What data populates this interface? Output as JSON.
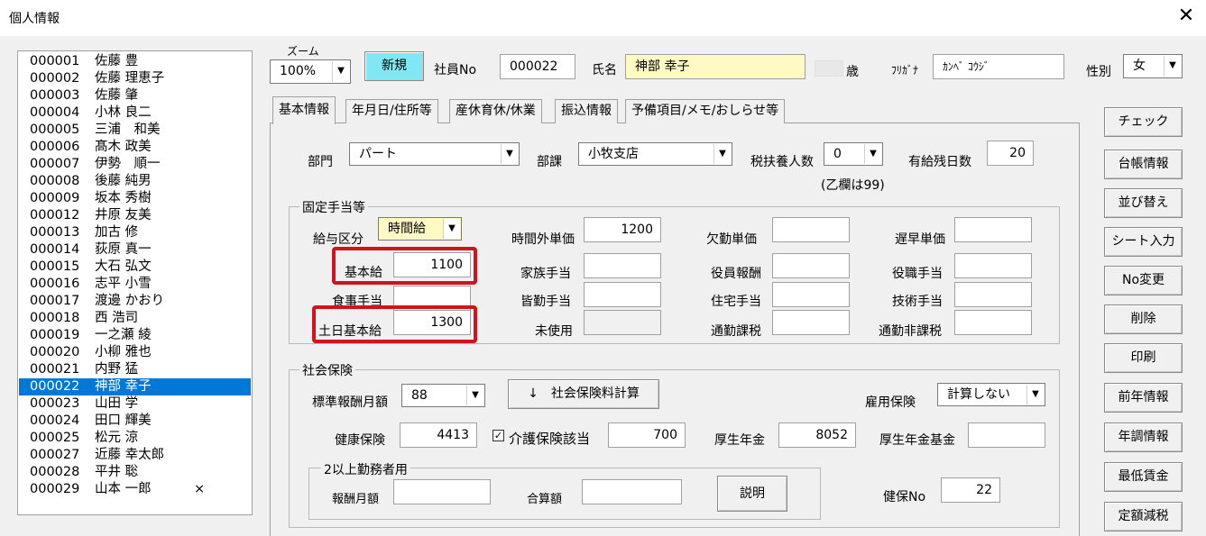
{
  "window": {
    "title": "個人情報",
    "close_glyph": "✕"
  },
  "employees": [
    {
      "no": "000001",
      "name": "佐藤 豊",
      "mark": ""
    },
    {
      "no": "000002",
      "name": "佐藤 理恵子",
      "mark": ""
    },
    {
      "no": "000003",
      "name": "佐藤 肇",
      "mark": ""
    },
    {
      "no": "000004",
      "name": "小林 良二",
      "mark": ""
    },
    {
      "no": "000005",
      "name": "三浦　和美",
      "mark": ""
    },
    {
      "no": "000006",
      "name": "髙木 政美",
      "mark": ""
    },
    {
      "no": "000007",
      "name": "伊勢　順一",
      "mark": ""
    },
    {
      "no": "000008",
      "name": "後藤 純男",
      "mark": ""
    },
    {
      "no": "000009",
      "name": "坂本 秀樹",
      "mark": ""
    },
    {
      "no": "000012",
      "name": "井原 友美",
      "mark": ""
    },
    {
      "no": "000013",
      "name": "加古 修",
      "mark": ""
    },
    {
      "no": "000014",
      "name": "荻原 真一",
      "mark": ""
    },
    {
      "no": "000015",
      "name": "大石 弘文",
      "mark": ""
    },
    {
      "no": "000016",
      "name": "志平 小雪",
      "mark": ""
    },
    {
      "no": "000017",
      "name": "渡邊 かおり",
      "mark": ""
    },
    {
      "no": "000018",
      "name": "西 浩司",
      "mark": ""
    },
    {
      "no": "000019",
      "name": "一之瀬 綾",
      "mark": ""
    },
    {
      "no": "000020",
      "name": "小柳 雅也",
      "mark": ""
    },
    {
      "no": "000021",
      "name": "内野 猛",
      "mark": ""
    },
    {
      "no": "000022",
      "name": "神部 幸子",
      "mark": ""
    },
    {
      "no": "000023",
      "name": "山田 学",
      "mark": ""
    },
    {
      "no": "000024",
      "name": "田口 輝美",
      "mark": ""
    },
    {
      "no": "000025",
      "name": "松元 涼",
      "mark": ""
    },
    {
      "no": "000027",
      "name": "近藤 幸太郎",
      "mark": ""
    },
    {
      "no": "000028",
      "name": "平井 聡",
      "mark": ""
    },
    {
      "no": "000029",
      "name": "山本 一郎",
      "mark": "×"
    }
  ],
  "selected_employee_no": "000022",
  "header": {
    "zoom_label": "ズーム",
    "zoom_value": "100%",
    "new_button": "新規",
    "emp_no_label": "社員No",
    "emp_no_value": "000022",
    "name_label": "氏名",
    "name_value": "神部 幸子",
    "age_value": "",
    "age_label": "歳",
    "furigana_label": "ﾌﾘｶﾞﾅ",
    "furigana_value": "ｶﾝﾍﾞ ｺｳｼﾞ",
    "gender_label": "性別",
    "gender_value": "女"
  },
  "tabs": [
    "基本情報",
    "年月日/住所等",
    "産休育休/休業",
    "振込情報",
    "予備項目/メモ/おしらせ等"
  ],
  "active_tab": "基本情報",
  "dept": {
    "dept_label": "部門",
    "dept_value": "パート",
    "section_label": "部課",
    "section_value": "小牧支店",
    "dependents_label": "税扶養人数",
    "dependents_value": "0",
    "dependents_note": "(乙欄は99)",
    "paid_leave_label": "有給残日数",
    "paid_leave_value": "20"
  },
  "fixed": {
    "caption": "固定手当等",
    "pay_type_label": "給与区分",
    "pay_type_value": "時間給",
    "base_label": "基本給",
    "base_value": "1100",
    "meal_label": "食事手当",
    "meal_value": "",
    "weekend_label": "土日基本給",
    "weekend_value": "1300",
    "overtime_label": "時間外単価",
    "overtime_value": "1200",
    "family_label": "家族手当",
    "family_value": "",
    "attendance_label": "皆勤手当",
    "attendance_value": "",
    "unused_label": "未使用",
    "unused_value": "",
    "absence_label": "欠勤単価",
    "absence_value": "",
    "officer_label": "役員報酬",
    "officer_value": "",
    "housing_label": "住宅手当",
    "housing_value": "",
    "commute_tax_label": "通勤課税",
    "commute_tax_value": "",
    "late_label": "遅早単価",
    "late_value": "",
    "position_label": "役職手当",
    "position_value": "",
    "skill_label": "技術手当",
    "skill_value": "",
    "commute_free_label": "通勤非課税",
    "commute_free_value": ""
  },
  "insurance": {
    "caption": "社会保険",
    "std_label": "標準報酬月額",
    "std_value": "88",
    "calc_button": "↓　社会保険料計算",
    "employment_label": "雇用保険",
    "employment_value": "計算しない",
    "health_label": "健康保険",
    "health_value": "4413",
    "care_check": "✓",
    "care_label": "介護保険該当",
    "care_value": "700",
    "pension_label": "厚生年金",
    "pension_value": "8052",
    "pension_fund_label": "厚生年金基金",
    "pension_fund_value": "",
    "multi_caption": "2以上勤務者用",
    "multi_monthly_label": "報酬月額",
    "multi_monthly_value": "",
    "multi_total_label": "合算額",
    "multi_total_value": "",
    "explain_button": "説明",
    "health_no_label": "健保No",
    "health_no_value": "22"
  },
  "side_buttons": [
    "チェック",
    "台帳情報",
    "並び替え",
    "シート入力",
    "No変更",
    "削除",
    "印刷",
    "前年情報",
    "年調情報",
    "最低賃金",
    "定額減税"
  ],
  "colors": {
    "selection": "#0078d7",
    "new_button": "#7fe8f4",
    "name_field": "#fff9c4",
    "highlight": "#d0131f"
  }
}
